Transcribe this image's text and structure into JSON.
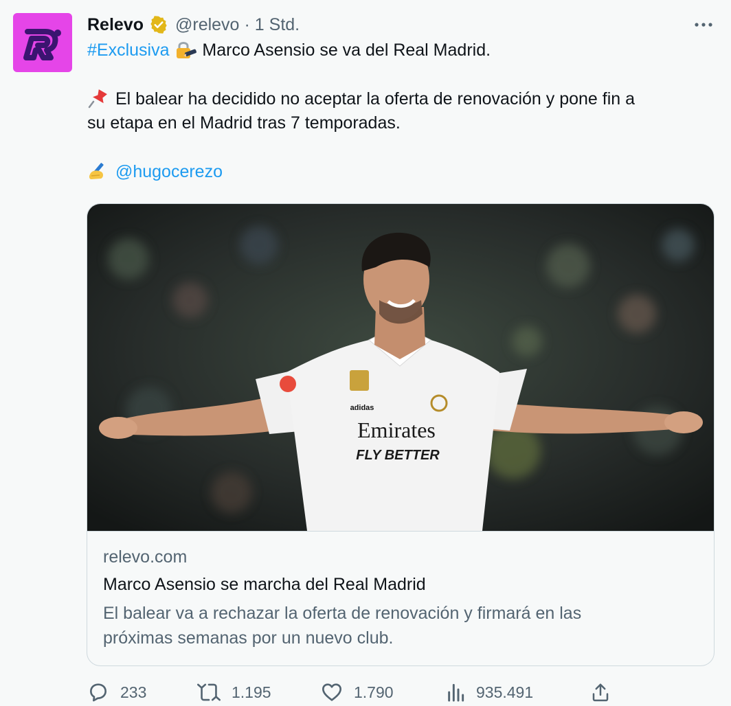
{
  "author": {
    "name": "Relevo",
    "handle": "@relevo",
    "separator": "·",
    "time": "1 Std.",
    "avatar_color": "#e545e8",
    "verified_icon": "verified-gold-badge-icon"
  },
  "tweet": {
    "hashtag": "#Exclusiva",
    "headline": " Marco Asensio se va del Real Madrid.",
    "paragraph_line1": " El balear ha decidido no aceptar la oferta de renovación y pone fin a",
    "paragraph_line2": "su etapa en el Madrid tras 7 temporadas.",
    "mention": "@hugocerezo",
    "emojis": [
      "lock-with-pen-emoji",
      "pushpin-emoji",
      "writing-hand-emoji"
    ]
  },
  "card": {
    "domain": "relevo.com",
    "title": "Marco Asensio se marcha del Real Madrid",
    "description_line1": "El balear va a rechazar la oferta de renovación y firmará en las",
    "description_line2": "próximas semanas por un nuevo club.",
    "image_jersey_sponsor_line1": "Emirates",
    "image_jersey_sponsor_line2": "FLY BETTER",
    "image_jersey_brand": "adidas"
  },
  "actions": {
    "replies": "233",
    "retweets": "1.195",
    "likes": "1.790",
    "views": "935.491"
  },
  "colors": {
    "link": "#1d9bf0",
    "secondary_text": "#536471",
    "background": "#f7f9f9",
    "verified_gold": "#e2b719"
  }
}
